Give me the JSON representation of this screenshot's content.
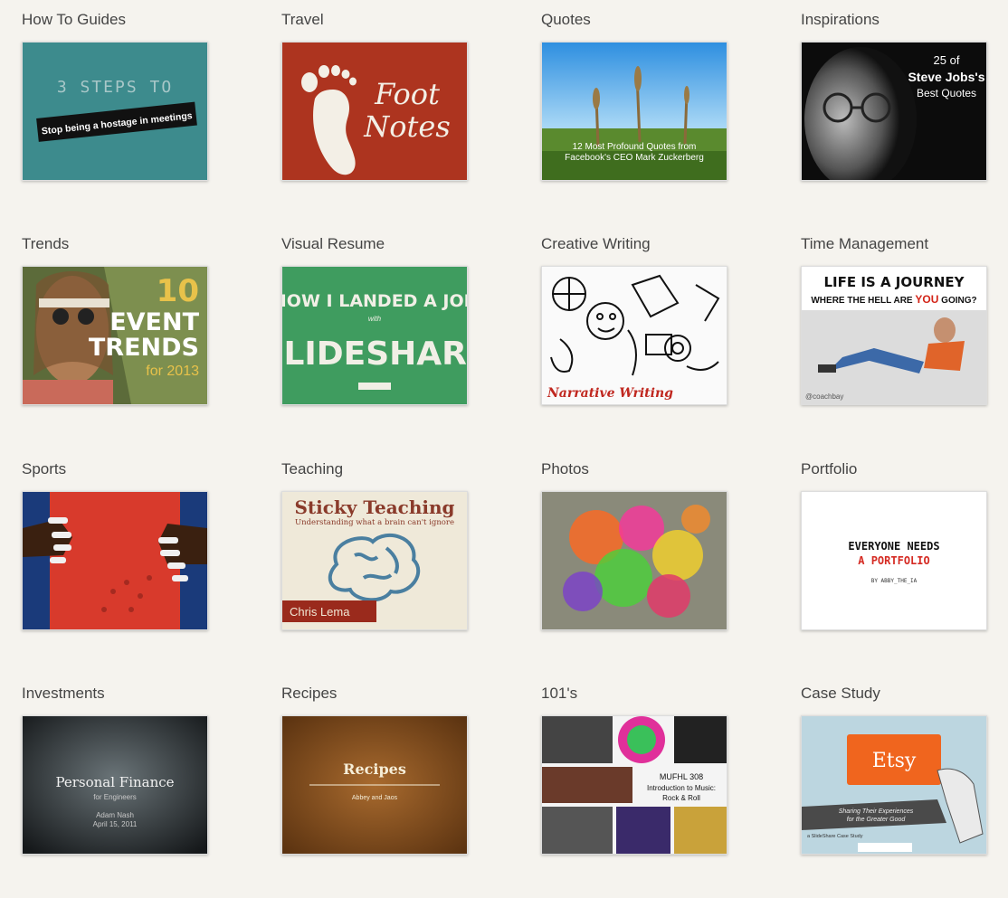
{
  "categories": [
    {
      "label": "How To Guides",
      "thumb": {
        "line1": "3 STEPS TO",
        "line2": "Stop being a hostage in meetings"
      }
    },
    {
      "label": "Travel",
      "thumb": {
        "line1": "Foot",
        "line2": "Notes"
      }
    },
    {
      "label": "Quotes",
      "thumb": {
        "line1": "12 Most Profound Quotes from",
        "line2": "Facebook's CEO Mark Zuckerberg"
      }
    },
    {
      "label": "Inspirations",
      "thumb": {
        "line1": "25 of",
        "line2": "Steve Jobs's",
        "line3": "Best Quotes"
      }
    },
    {
      "label": "Trends",
      "thumb": {
        "line1": "10",
        "line2": "EVENT",
        "line3": "TRENDS",
        "line4": "for 2013"
      }
    },
    {
      "label": "Visual Resume",
      "thumb": {
        "line1": "HOW I LANDED A JOB",
        "line2": "with",
        "line3": "SLIDESHARE"
      }
    },
    {
      "label": "Creative Writing",
      "thumb": {
        "line1": "Narrative Writing"
      }
    },
    {
      "label": "Time Management",
      "thumb": {
        "line1": "LIFE IS A JOURNEY",
        "line2": "WHERE THE HELL ARE",
        "line3": "YOU",
        "line4": "GOING?",
        "line5": "@coachbay"
      }
    },
    {
      "label": "Sports",
      "thumb": {}
    },
    {
      "label": "Teaching",
      "thumb": {
        "line1": "Sticky Teaching",
        "line2": "Understanding what a brain can't ignore",
        "line3": "Chris Lema"
      }
    },
    {
      "label": "Photos",
      "thumb": {}
    },
    {
      "label": "Portfolio",
      "thumb": {
        "line1": "EVERYONE NEEDS",
        "line2": "A PORTFOLIO",
        "line3": "BY ABBY_THE_IA"
      }
    },
    {
      "label": "Investments",
      "thumb": {
        "line1": "Personal Finance",
        "line2": "for Engineers",
        "line3": "Adam Nash",
        "line4": "April 15, 2011"
      }
    },
    {
      "label": "Recipes",
      "thumb": {
        "line1": "Recipes",
        "line2": "Abbey and Jaos"
      }
    },
    {
      "label": "101's",
      "thumb": {
        "line1": "MUFHL 308",
        "line2": "Introduction to Music:",
        "line3": "Rock & Roll"
      }
    },
    {
      "label": "Case Study",
      "thumb": {
        "line1": "Etsy",
        "line2": "Sharing Their Experiences",
        "line3": "for the Greater Good",
        "line4": "a SlideShare Case Study"
      }
    }
  ]
}
